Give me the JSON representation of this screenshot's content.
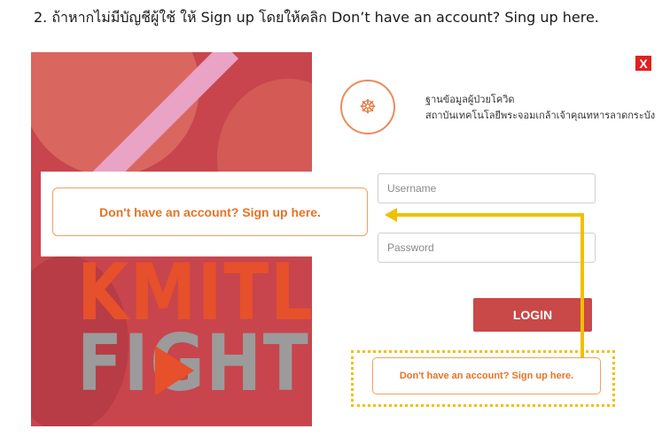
{
  "instruction": "2.  ถ้าหากไม่มีบัญชีผู้ใช้ ให้ Sign up โดยให้คลิก Don’t have an account? Sing up here.",
  "callout": {
    "label": "Don't have an account? Sign up here."
  },
  "poster": {
    "word1": "KMITL",
    "word2": "FIGHT"
  },
  "close_label": "X",
  "org": {
    "line1": "ฐานข้อมูลผู้ป่วยโควิด",
    "line2": "สถาบันเทคโนโลยีพระจอมเกล้าเจ้าคุณทหารลาดกระบัง"
  },
  "form": {
    "username_placeholder": "Username",
    "password_placeholder": "Password",
    "login_label": "LOGIN",
    "signup_label": "Don't have an account? Sign up here."
  },
  "colors": {
    "accent": "#e67324",
    "login": "#c94848",
    "highlight": "#f0c000",
    "close": "#e02020"
  }
}
